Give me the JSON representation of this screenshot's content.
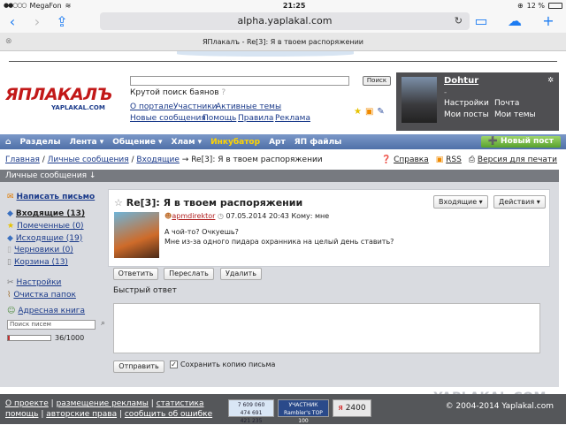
{
  "status": {
    "carrier": "MegaFon",
    "time": "21:25",
    "battery": "12 %"
  },
  "browser": {
    "url": "alpha.yaplakal.com",
    "tab_title": "ЯПлакалъ - Re[3]: Я в твоем распоряжении"
  },
  "header": {
    "logo": "ЯПЛАКАЛЪ",
    "logo_sub": "YAPLAKAL.COM",
    "search_button": "Поиск",
    "slogan": "Крутой поиск баянов",
    "links_row1": [
      "О портале",
      "Участники",
      "Активные темы"
    ],
    "links_row2": [
      "Новые сообщения",
      "Помощь",
      "Правила",
      "Реклама"
    ]
  },
  "user": {
    "name": "Dohtur",
    "dash": "-",
    "links": [
      "Настройки",
      "Почта",
      "Мои посты",
      "Мои темы"
    ]
  },
  "nav": {
    "items": [
      "Разделы",
      "Лента",
      "Общение",
      "Хлам",
      "Инкубатор",
      "Арт",
      "ЯП файлы"
    ],
    "new_post": "Новый пост"
  },
  "breadcrumb": {
    "home": "Главная",
    "pm": "Личные сообщения",
    "inbox": "Входящие",
    "current": "Re[3]: Я в твоем распоряжении"
  },
  "crumb_right": [
    "Справка",
    "RSS",
    "Версия для печати"
  ],
  "pm_bar": "Личные сообщения ↓",
  "sidebar": {
    "compose": "Написать письмо",
    "folders": [
      "Входящие (13)",
      "Помеченные (0)",
      "Исходящие (19)",
      "Черновики (0)",
      "Корзина (13)"
    ],
    "settings": "Настройки",
    "clean": "Очистка папок",
    "address": "Адресная книга",
    "search_placeholder": "Поиск писем",
    "quota": "36/1000",
    "quota_fraction": 0.036
  },
  "message": {
    "title": "Re[3]: Я в твоем распоряжении",
    "folder_dd": "Входящие",
    "actions_dd": "Действия",
    "author": "apmdirektor",
    "date": "07.05.2014 20:43",
    "to": "Кому: мне",
    "line1": "А чой-то? Очкуешь?",
    "line2": "Мне из-за одного пидара охранника на целый день ставить?"
  },
  "buttons": {
    "reply": "Ответить",
    "forward": "Переслать",
    "delete": "Удалить",
    "send": "Отправить"
  },
  "quick_reply": "Быстрый ответ",
  "save_copy": "Сохранить копию письма",
  "footer": {
    "row1": [
      "О проекте",
      "размещение рекламы",
      "статистика"
    ],
    "row2": [
      "помощь",
      "авторские права",
      "сообщить об ошибке"
    ],
    "counter": "7 609 060\n474 691\n421 235",
    "rambler": "УЧАСТНИК Rambler's TOP 100",
    "li": "2400",
    "copyright": "© 2004-2014 Yaplakal.com"
  },
  "watermark": "YAPLAKAL.COM"
}
